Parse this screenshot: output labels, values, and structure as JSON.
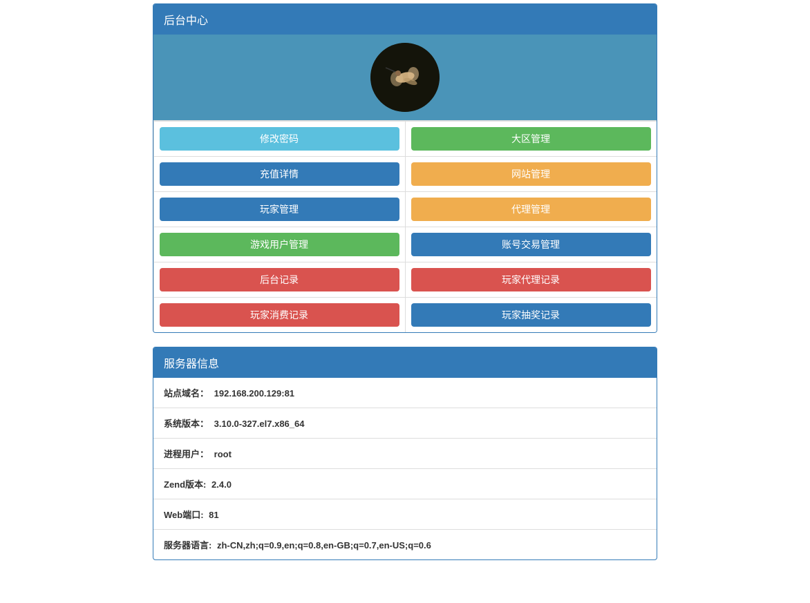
{
  "header": {
    "title": "后台中心"
  },
  "buttons": [
    {
      "label": "修改密码",
      "style": "btn-info"
    },
    {
      "label": "大区管理",
      "style": "btn-success"
    },
    {
      "label": "充值详情",
      "style": "btn-primary"
    },
    {
      "label": "网站管理",
      "style": "btn-warning"
    },
    {
      "label": "玩家管理",
      "style": "btn-primary"
    },
    {
      "label": "代理管理",
      "style": "btn-warning"
    },
    {
      "label": "游戏用户管理",
      "style": "btn-success"
    },
    {
      "label": "账号交易管理",
      "style": "btn-primary"
    },
    {
      "label": "后台记录",
      "style": "btn-danger"
    },
    {
      "label": "玩家代理记录",
      "style": "btn-danger"
    },
    {
      "label": "玩家消费记录",
      "style": "btn-danger"
    },
    {
      "label": "玩家抽奖记录",
      "style": "btn-primary"
    }
  ],
  "server_info": {
    "title": "服务器信息",
    "items": [
      {
        "label": "站点域名：",
        "value": "192.168.200.129:81"
      },
      {
        "label": "系统版本：",
        "value": "3.10.0-327.el7.x86_64"
      },
      {
        "label": "进程用户：",
        "value": "root"
      },
      {
        "label": "Zend版本:",
        "value": "2.4.0"
      },
      {
        "label": "Web端口:",
        "value": "81"
      },
      {
        "label": "服务器语言:",
        "value": "zh-CN,zh;q=0.9,en;q=0.8,en-GB;q=0.7,en-US;q=0.6"
      }
    ]
  }
}
